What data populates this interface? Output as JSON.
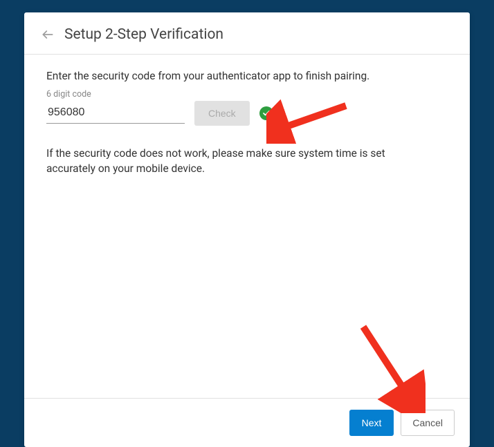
{
  "header": {
    "title": "Setup 2-Step Verification"
  },
  "body": {
    "instruction": "Enter the security code from your authenticator app to finish pairing.",
    "input_label": "6 digit code",
    "code_value": "956080",
    "check_button": "Check",
    "help_text": "If the security code does not work, please make sure system time is set accurately on your mobile device."
  },
  "footer": {
    "next": "Next",
    "cancel": "Cancel"
  },
  "colors": {
    "primary": "#057fd0",
    "success": "#2e9e3f",
    "annotation": "#f0301e"
  }
}
